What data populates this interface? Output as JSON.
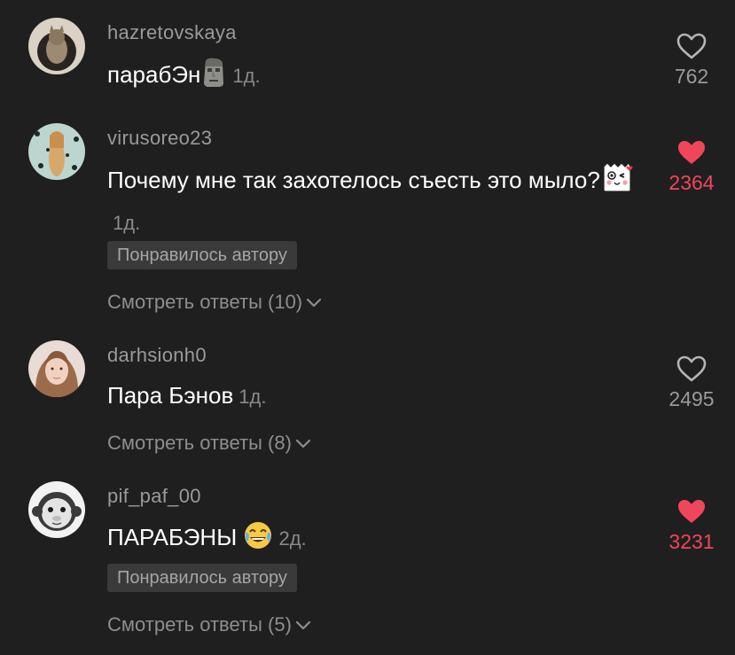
{
  "colors": {
    "background": "#1f1f1f",
    "liked_heart": "#f0465c",
    "muted_text": "#8e8e8e"
  },
  "comments": [
    {
      "username": "hazretovskaya",
      "text": "парабЭн",
      "emoji": "moai-emoji",
      "time": "1д.",
      "likes": "762",
      "liked": false
    },
    {
      "username": "virusoreo23",
      "text": "Почему мне так захотелось съесть это мыло?",
      "emoji": "sticker-emoji",
      "time": "1д.",
      "likes": "2364",
      "liked": true,
      "liked_by_author": "Понравилось автору",
      "replies": "Смотреть ответы (10)"
    },
    {
      "username": "darhsionh0",
      "text": "Пара Бэнов",
      "time": "1д.",
      "likes": "2495",
      "liked": false,
      "replies": "Смотреть ответы (8)"
    },
    {
      "username": "pif_paf_00",
      "text": "ПАРАБЭНЫ",
      "emoji": "joy-emoji",
      "time": "2д.",
      "likes": "3231",
      "liked": true,
      "liked_by_author": "Понравилось автору",
      "replies": "Смотреть ответы (5)"
    }
  ]
}
